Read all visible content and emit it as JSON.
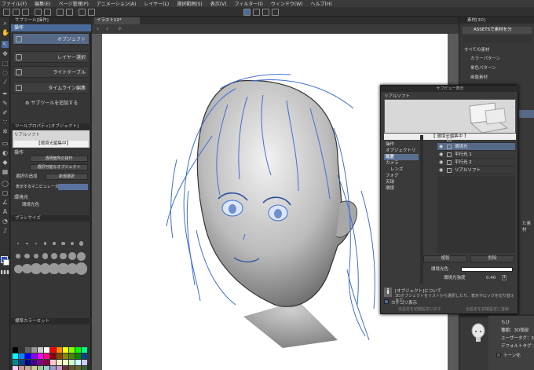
{
  "menu": [
    "ファイル(F)",
    "編集(E)",
    "ページ管理(P)",
    "アニメーション(A)",
    "レイヤー(L)",
    "選択範囲(S)",
    "表示(V)",
    "フィルター(I)",
    "ウィンドウ(W)",
    "ヘルプ(H)"
  ],
  "document_tab": "イラスト12*",
  "sub_tool_panel": {
    "header": "サブツール[操作]",
    "group_label": "操作",
    "items": [
      {
        "label": "オブジェクト",
        "active": true
      },
      {
        "label": "レイヤー選択",
        "active": false
      },
      {
        "label": "ライトテーブル",
        "active": false
      },
      {
        "label": "タイムライン編集",
        "active": false
      }
    ],
    "add_button": "サブツールを追加する"
  },
  "tool_property": {
    "header": "ツールプロパティ[オブジェクト]",
    "preset_name": "リアルソフト",
    "editing_label": "【環境光編集中】",
    "section": "操作",
    "rows": [
      {
        "label": "",
        "value": "透明箇所の操作"
      },
      {
        "label": "",
        "value": "選択可能なオブジェクト"
      },
      {
        "label": "選択の追加",
        "value": "新規選択"
      },
      {
        "label": "表示するマニピュレーター",
        "value": ""
      }
    ],
    "env_light_label": "環境光",
    "env_light_color_label": "環境光色"
  },
  "brush_size": {
    "header": "ブラシサイズ"
  },
  "color_set": {
    "header": "標準カラーセット"
  },
  "material_panel": {
    "header": "素材[3D]",
    "assets_button": "ASSETSで素材を分",
    "items": [
      "すべての素材",
      "カラーパターン",
      "単色パターン",
      "画像素材"
    ],
    "side_label": "た素材"
  },
  "sub_view": {
    "title": "サブビュー表示",
    "panel_label": "リアルソフト",
    "preview_caption": "【 環境光編集中 】",
    "nav": [
      "操作",
      "オブジェクトリスト",
      "配置",
      "カメラ",
      "レンズ",
      "フォグ",
      "天球",
      "環境"
    ],
    "nav_selected": "配置",
    "layers": [
      {
        "name": "カメラ",
        "visible": false,
        "selected": false
      },
      {
        "name": "環境光",
        "visible": true,
        "selected": true
      },
      {
        "name": "平行光 1",
        "visible": true,
        "selected": false
      },
      {
        "name": "平行光 2",
        "visible": true,
        "selected": false
      },
      {
        "name": "リアルソフト",
        "visible": true,
        "selected": false
      }
    ],
    "copy_button": "複製",
    "delete_button": "削除",
    "env_color_label": "環境光色",
    "env_strength_label": "環境光強度",
    "env_strength_value": "0.40",
    "info_heading": "[オブジェクト]について",
    "info_body": "3Dオブジェクトをリストから選択したり、表示やロックを切り替えます",
    "category_checkbox": "カテゴリ表示",
    "footer_left": "全設定を初期設定に戻す",
    "footer_right": "全設定を初期設定に登録"
  },
  "bottom_props": {
    "name": "ちび",
    "type_label": "種類：3D頭部",
    "user_tag_label": "ユーザータグ：3D",
    "default_tag_label": "デフォルトタグ：3D",
    "toon_label": "トーン化"
  },
  "colors": {
    "accent": "#4a6a9a",
    "selection": "#566a88",
    "sketch": "#3e6fd6"
  }
}
